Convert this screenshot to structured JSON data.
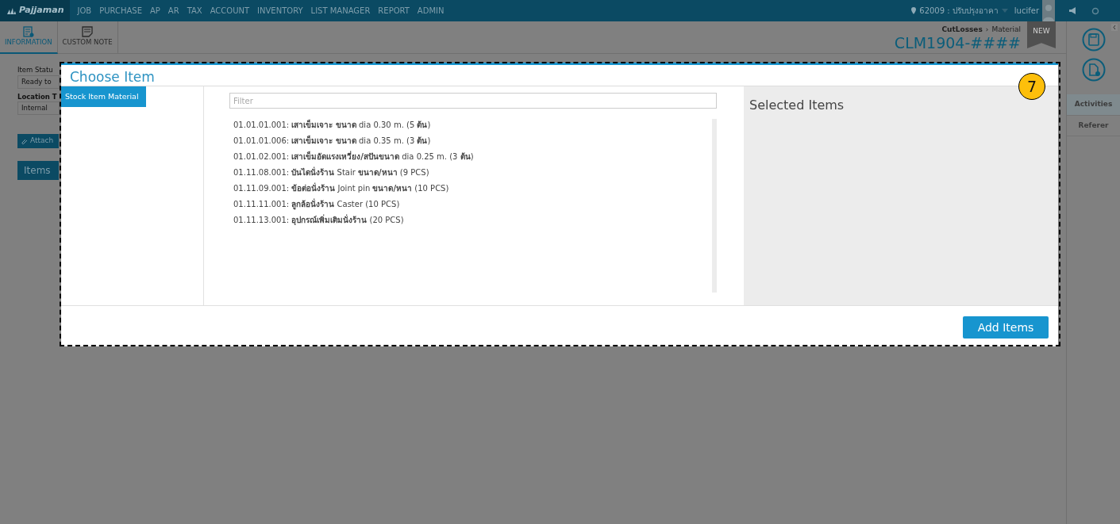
{
  "top_bar": {
    "logo": "Pajjaman",
    "menu": [
      "JOB",
      "PURCHASE",
      "AP",
      "AR",
      "TAX",
      "ACCOUNT",
      "INVENTORY",
      "LIST MANAGER",
      "REPORT",
      "ADMIN"
    ],
    "branch": "62009 : ปรับปรุงอาคา",
    "user": "lucifer"
  },
  "page_tabs": [
    {
      "label": "INFORMATION",
      "selected": true
    },
    {
      "label": "CUSTOM NOTE",
      "selected": false
    }
  ],
  "header": {
    "module": "CutLosses",
    "separator": "›",
    "page": "Material",
    "document_number": "CLM1904-####",
    "badge": "NEW"
  },
  "form": {
    "status_label": "Item Statu",
    "status_value": "Ready to",
    "location_label": "Location T",
    "location_value": "Internal",
    "attach_button": "Attach",
    "items_tab": "Items"
  },
  "side_panel": {
    "links": [
      {
        "label": "Activities",
        "selected": true
      },
      {
        "label": "Referer",
        "selected": false
      }
    ]
  },
  "dialog": {
    "title": "Choose Item",
    "categories": [
      {
        "label": "Stock Item Material",
        "selected": true
      }
    ],
    "filter": {
      "placeholder": "Filter"
    },
    "items": [
      "01.01.01.001: **เสาเข็มเจาะ ขนาด** dia 0.30 m. (5 **ต้น**)",
      "01.01.01.006: **เสาเข็มเจาะ ขนาด** dia 0.35 m. (3 **ต้น**)",
      "01.01.02.001: **เสาเข็มอัดแรงเหวี่ยง/สปันขนาด** dia 0.25 m. (3 **ต้น**)",
      "01.11.08.001: **บันไดนั่งร้าน** Stair **ขนาด/หนา** (9 PCS)",
      "01.11.09.001: **ข้อต่อนั่งร้าน** Joint pin **ขนาด/หนา** (10 PCS)",
      "01.11.11.001: **ลูกล้อนั่งร้าน** Caster (10 PCS)",
      "01.11.13.001: **อุปกรณ์เพิ่มเติมนั่งร้าน** (20 PCS)"
    ],
    "selected_title": "Selected Items",
    "add_button": "Add Items"
  },
  "callout": "7"
}
